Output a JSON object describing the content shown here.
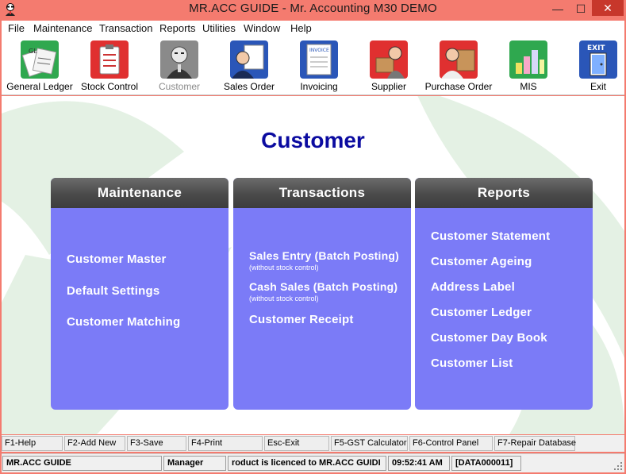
{
  "window": {
    "title": "MR.ACC GUIDE - Mr. Accounting M30 DEMO",
    "controls": {
      "minimize": "—",
      "maximize": "☐",
      "close": "✕"
    }
  },
  "menu": [
    "File",
    "Maintenance",
    "Transaction",
    "Reports",
    "Utilities",
    "Window",
    "Help"
  ],
  "toolbar": [
    {
      "label": "General Ledger",
      "icon": "general-ledger-icon",
      "enabled": true
    },
    {
      "label": "Stock Control",
      "icon": "stock-control-icon",
      "enabled": true
    },
    {
      "label": "Customer",
      "icon": "customer-icon",
      "enabled": false
    },
    {
      "label": "Sales Order",
      "icon": "sales-order-icon",
      "enabled": true
    },
    {
      "label": "Invoicing",
      "icon": "invoicing-icon",
      "enabled": true
    },
    {
      "label": "Supplier",
      "icon": "supplier-icon",
      "enabled": true
    },
    {
      "label": "Purchase Order",
      "icon": "purchase-order-icon",
      "enabled": true
    },
    {
      "label": "MIS",
      "icon": "mis-icon",
      "enabled": true
    },
    {
      "label": "Exit",
      "icon": "exit-icon",
      "enabled": true,
      "icon_text": "EXIT"
    }
  ],
  "icon_text": {
    "ledger": "GL",
    "invoice": "INVOICE"
  },
  "main": {
    "title": "Customer",
    "panels": {
      "maintenance": {
        "title": "Maintenance",
        "items": [
          "Customer Master",
          "Default Settings",
          "Customer Matching"
        ]
      },
      "transactions": {
        "title": "Transactions",
        "items": [
          {
            "label": "Sales Entry (Batch Posting)",
            "note": "(without stock control)"
          },
          {
            "label": "Cash Sales (Batch Posting)",
            "note": "(without stock control)"
          },
          {
            "label": "Customer Receipt",
            "note": ""
          }
        ]
      },
      "reports": {
        "title": "Reports",
        "items": [
          "Customer Statement",
          "Customer Ageing",
          "Address Label",
          "Customer Ledger",
          "Customer Day Book",
          "Customer List"
        ]
      }
    }
  },
  "function_keys": [
    "F1-Help",
    "F2-Add New",
    "F3-Save",
    "F4-Print",
    "Esc-Exit",
    "F5-GST Calculator",
    "F6-Control Panel",
    "F7-Repair Database"
  ],
  "status": {
    "company": "MR.ACC GUIDE",
    "user": "Manager",
    "licence": "roduct is licenced to MR.ACC GUIDI",
    "time": "09:52:41 AM",
    "data": "[DATA000011]"
  },
  "colors": {
    "frame": "#f47b6f",
    "panel_body": "#7b7bf7",
    "panel_header": "#4a4a4a",
    "title": "#0b0ba0",
    "close_button": "#c7372b"
  }
}
